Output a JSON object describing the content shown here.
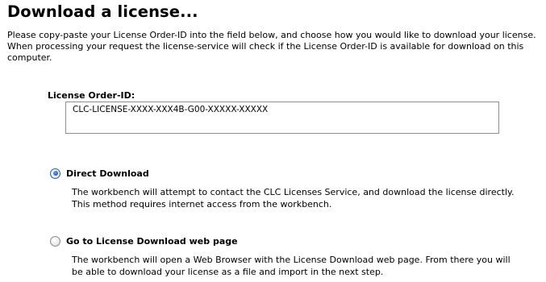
{
  "title": "Download a license...",
  "intro": {
    "line1": "Please copy-paste your License Order-ID into the field below, and choose how you would like to download your license.",
    "line2": "When processing your request the license-service will check if the License Order-ID is available for download on this computer."
  },
  "order_id": {
    "label": "License Order-ID:",
    "value": "CLC-LICENSE-XXXX-XXX4B-G00-XXXXX-XXXXX"
  },
  "options": {
    "direct": {
      "label": "Direct Download",
      "selected": true,
      "desc_line1": "The workbench will attempt to contact the CLC Licenses Service, and download the license directly.",
      "desc_line2": "This method requires internet access from the workbench."
    },
    "webpage": {
      "label": "Go to License Download web page",
      "selected": false,
      "desc_line1": "The workbench will open a Web Browser with the License Download web page. From there you will",
      "desc_line2": "be able to download your license as a file and import in the next step."
    }
  }
}
